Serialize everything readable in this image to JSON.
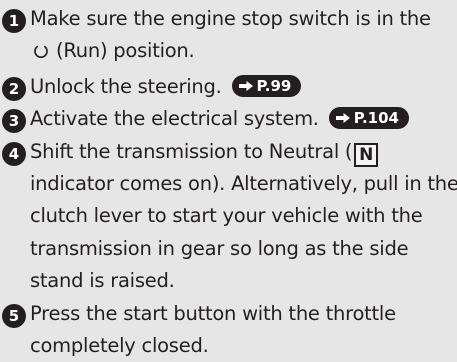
{
  "steps": [
    {
      "number": "1",
      "text_before": "Make sure the engine stop switch is in the",
      "icon": "run-position-icon",
      "text_after": "(Run) position."
    },
    {
      "number": "2",
      "text": "Unlock the steering.",
      "ref": "P.99"
    },
    {
      "number": "3",
      "text": "Activate the electrical system.",
      "ref": "P.104"
    },
    {
      "number": "4",
      "text_before": "Shift the transmission to Neutral (",
      "indicator": "N",
      "text_after": "indicator comes on). Alternatively, pull in the",
      "continuation": [
        "clutch lever to start your vehicle with the",
        "transmission in gear so long as the side",
        "stand is raised."
      ]
    },
    {
      "number": "5",
      "text": "Press the start button with the throttle",
      "continuation": [
        "completely closed."
      ]
    }
  ],
  "colors": {
    "background": "#e6e6e6",
    "text": "#231f20",
    "badge": "#231f20"
  }
}
